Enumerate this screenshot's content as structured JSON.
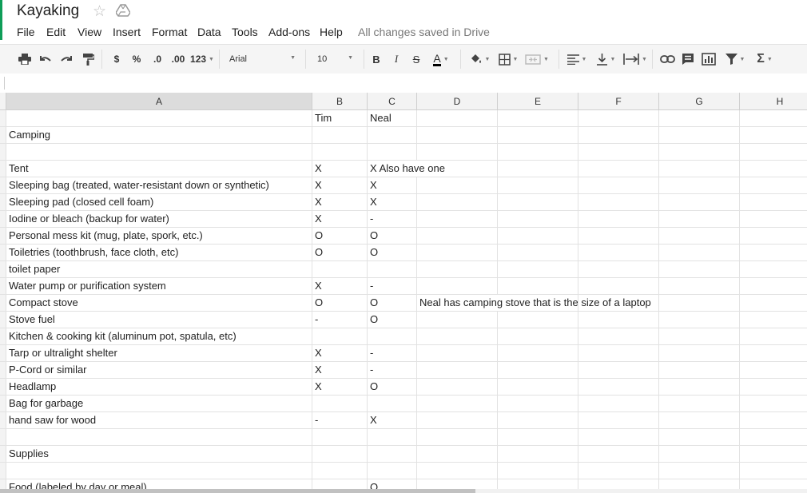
{
  "doc": {
    "title": "Kayaking",
    "save_status": "All changes saved in Drive"
  },
  "menu": [
    "File",
    "Edit",
    "View",
    "Insert",
    "Format",
    "Data",
    "Tools",
    "Add-ons",
    "Help"
  ],
  "toolbar": {
    "currency_label": "$",
    "percent_label": "%",
    "decrease_decimal_label": ".0",
    "increase_decimal_label": ".00",
    "more_formats_label": "123",
    "font": "Arial",
    "font_size": "10",
    "bold_label": "B",
    "italic_label": "I",
    "strike_label": "S",
    "text_color_label": "A",
    "sum_label": "Σ"
  },
  "columns": [
    "A",
    "B",
    "C",
    "D",
    "E",
    "F",
    "G",
    "H"
  ],
  "rows": [
    [
      "",
      "Tim",
      "Neal",
      ""
    ],
    [
      "Camping",
      "",
      "",
      ""
    ],
    [
      "",
      "",
      "",
      ""
    ],
    [
      "Tent",
      "X",
      "X Also have one",
      ""
    ],
    [
      "Sleeping bag    (treated, water-resistant down or synthetic)",
      "X",
      "X",
      ""
    ],
    [
      "Sleeping pad  (closed cell foam)",
      "X",
      "X",
      ""
    ],
    [
      "Iodine or bleach (backup for water)",
      "X",
      "-",
      ""
    ],
    [
      "Personal mess kit (mug, plate, spork, etc.)",
      "O",
      "O",
      ""
    ],
    [
      "Toiletries   (toothbrush, face cloth, etc)",
      "O",
      "O",
      ""
    ],
    [
      "toilet paper",
      "",
      "",
      ""
    ],
    [
      "Water pump or purification system",
      "X",
      "-",
      ""
    ],
    [
      "Compact stove",
      "O",
      "O",
      "Neal has camping stove that is the size of a laptop"
    ],
    [
      "Stove fuel",
      "-",
      "O",
      ""
    ],
    [
      "Kitchen & cooking kit  (aluminum pot, spatula, etc)",
      "",
      "",
      ""
    ],
    [
      "Tarp or ultralight shelter",
      "X",
      "-",
      ""
    ],
    [
      "P-Cord or similar",
      "X",
      "-",
      ""
    ],
    [
      "Headlamp",
      "X",
      "O",
      ""
    ],
    [
      "Bag for garbage",
      "",
      "",
      ""
    ],
    [
      "hand saw for wood",
      "-",
      "X",
      ""
    ],
    [
      "",
      "",
      "",
      ""
    ],
    [
      "Supplies",
      "",
      "",
      ""
    ],
    [
      "",
      "",
      "",
      ""
    ],
    [
      "Food (labeled by day or meal)",
      "",
      "O",
      ""
    ]
  ]
}
